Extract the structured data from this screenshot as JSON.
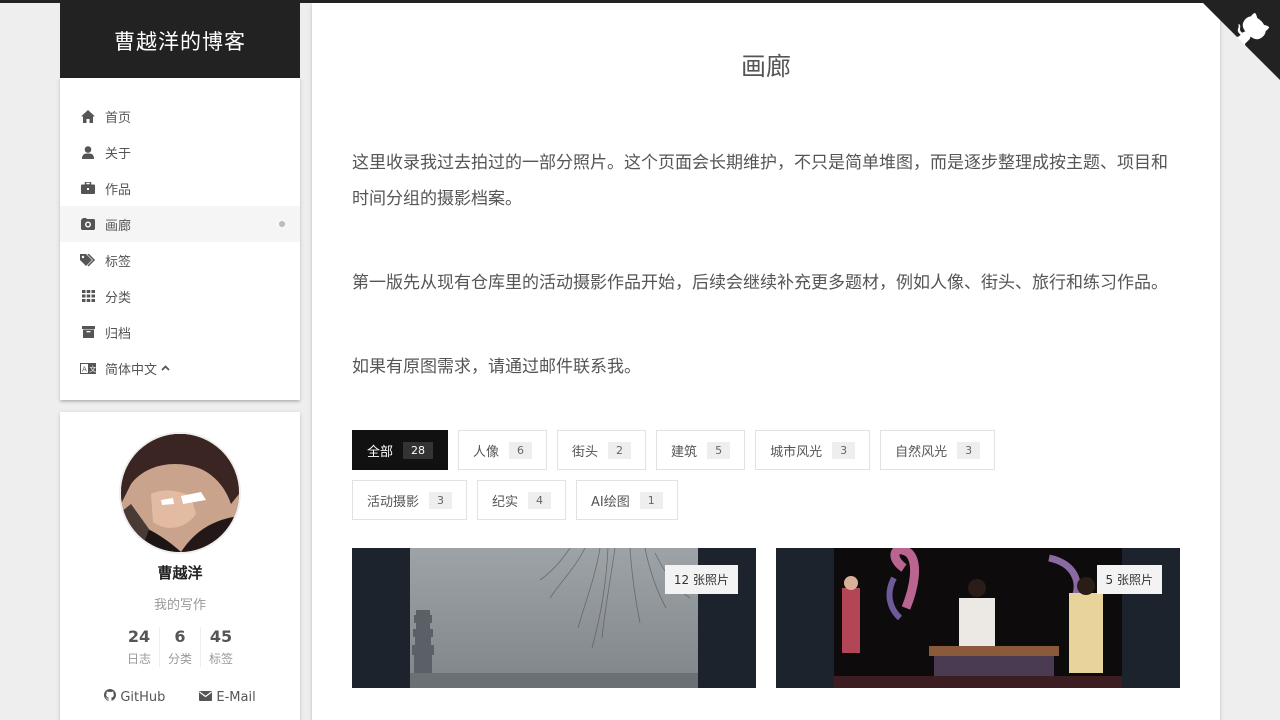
{
  "site": {
    "title": "曹越洋的博客"
  },
  "menu": [
    {
      "key": "home",
      "label": "首页",
      "icon": "home-icon"
    },
    {
      "key": "about",
      "label": "关于",
      "icon": "user-icon"
    },
    {
      "key": "works",
      "label": "作品",
      "icon": "briefcase-icon"
    },
    {
      "key": "gallery",
      "label": "画廊",
      "icon": "camera-icon",
      "active": true
    },
    {
      "key": "tags",
      "label": "标签",
      "icon": "tags-icon"
    },
    {
      "key": "categories",
      "label": "分类",
      "icon": "grid-icon"
    },
    {
      "key": "archives",
      "label": "归档",
      "icon": "archive-icon"
    }
  ],
  "language": {
    "label": "简体中文",
    "icon": "language-icon"
  },
  "author": {
    "name": "曹越洋",
    "description": "我的写作",
    "stats": [
      {
        "num": "24",
        "label": "日志"
      },
      {
        "num": "6",
        "label": "分类"
      },
      {
        "num": "45",
        "label": "标签"
      }
    ],
    "links": [
      {
        "label": "GitHub",
        "icon": "github-icon"
      },
      {
        "label": "E-Mail",
        "icon": "envelope-icon"
      }
    ]
  },
  "page": {
    "title": "画廊",
    "paragraphs": [
      "这里收录我过去拍过的一部分照片。这个页面会长期维护，不只是简单堆图，而是逐步整理成按主题、项目和时间分组的摄影档案。",
      "第一版先从现有仓库里的活动摄影作品开始，后续会继续补充更多题材，例如人像、街头、旅行和练习作品。",
      "如果有原图需求，请通过邮件联系我。"
    ]
  },
  "filters": [
    {
      "label": "全部",
      "count": "28",
      "active": true
    },
    {
      "label": "人像",
      "count": "6"
    },
    {
      "label": "街头",
      "count": "2"
    },
    {
      "label": "建筑",
      "count": "5"
    },
    {
      "label": "城市风光",
      "count": "3"
    },
    {
      "label": "自然风光",
      "count": "3"
    },
    {
      "label": "活动摄影",
      "count": "3"
    },
    {
      "label": "纪实",
      "count": "4"
    },
    {
      "label": "AI绘图",
      "count": "1"
    }
  ],
  "albums": [
    {
      "badge": "12 张照片"
    },
    {
      "badge": "5 张照片"
    }
  ],
  "colors": {
    "brand_bg": "#222222",
    "active_chip": "#111111",
    "page_bg": "#eeeeee"
  }
}
